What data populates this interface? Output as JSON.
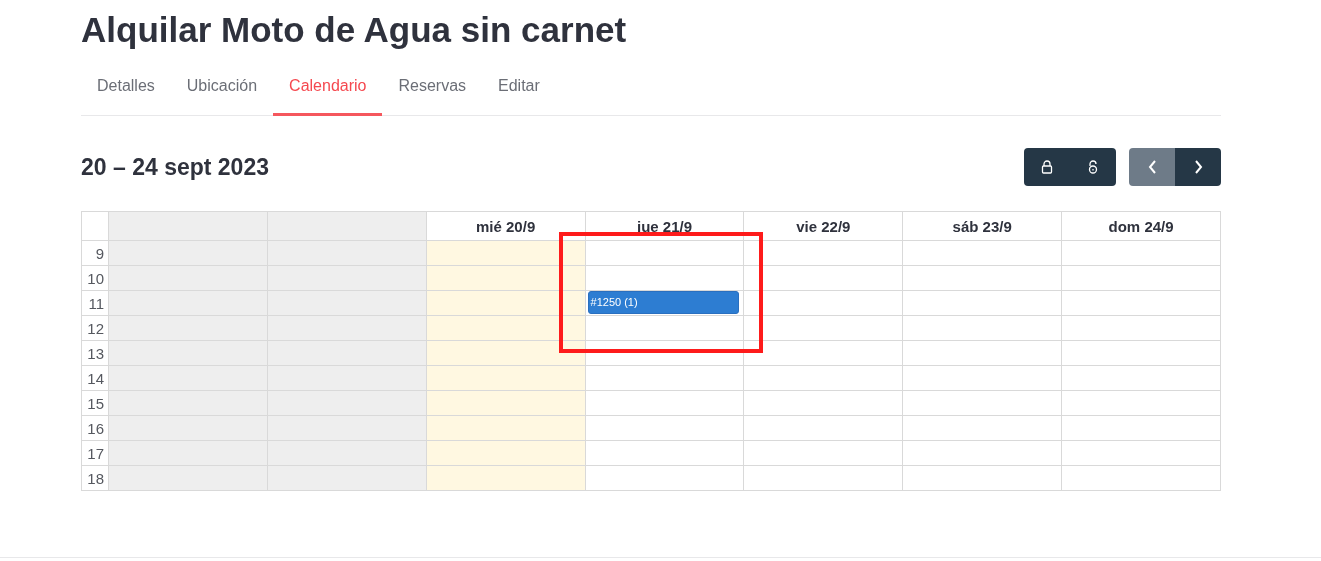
{
  "title": "Alquilar Moto de Agua sin carnet",
  "tabs": [
    {
      "label": "Detalles",
      "selected": false
    },
    {
      "label": "Ubicación",
      "selected": false
    },
    {
      "label": "Calendario",
      "selected": true
    },
    {
      "label": "Reservas",
      "selected": false
    },
    {
      "label": "Editar",
      "selected": false
    }
  ],
  "calendar": {
    "range": "20 – 24 sept 2023",
    "lock_buttons": [
      {
        "kind": "lock"
      },
      {
        "kind": "unlock"
      }
    ],
    "nav_buttons": [
      {
        "kind": "prev",
        "disabled": true
      },
      {
        "kind": "next",
        "disabled": false
      }
    ],
    "rows": [
      {
        "hour": "9"
      },
      {
        "hour": "10"
      },
      {
        "hour": "11",
        "cells": [
          {},
          {},
          {},
          {
            "event": "#1250 (1)"
          },
          {},
          {},
          {}
        ]
      },
      {
        "hour": "12"
      },
      {
        "hour": "13"
      },
      {
        "hour": "14"
      },
      {
        "hour": "15"
      },
      {
        "hour": "16"
      },
      {
        "hour": "17"
      },
      {
        "hour": "18"
      }
    ],
    "days": [
      {
        "disabled": true
      },
      {
        "disabled": true
      },
      {
        "label": "mié 20/9",
        "disabled": false,
        "today": true
      },
      {
        "label": "jue 21/9",
        "disabled": false,
        "today": false
      },
      {
        "label": "vie 22/9",
        "disabled": false,
        "today": false
      },
      {
        "label": "sáb 23/9",
        "disabled": false,
        "today": false
      },
      {
        "label": "dom 24/9",
        "disabled": false,
        "today": false
      }
    ]
  }
}
